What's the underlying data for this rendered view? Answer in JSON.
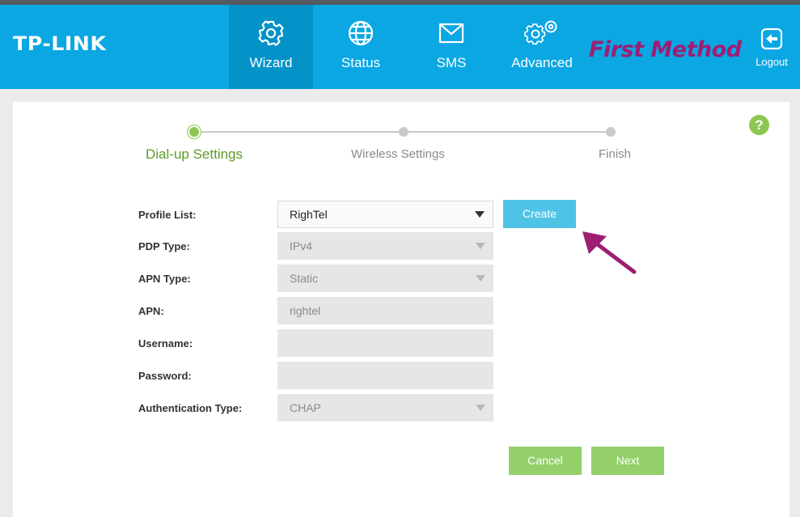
{
  "brand": {
    "logo": "TP-LINK"
  },
  "nav": {
    "items": [
      {
        "label": "Wizard",
        "icon": "gear-icon"
      },
      {
        "label": "Status",
        "icon": "globe-icon"
      },
      {
        "label": "SMS",
        "icon": "envelope-icon"
      },
      {
        "label": "Advanced",
        "icon": "gears-icon"
      }
    ],
    "logout_label": "Logout"
  },
  "annotation": {
    "text": "First Method",
    "color": "#9c1f74"
  },
  "steps": [
    {
      "label": "Dial-up Settings"
    },
    {
      "label": "Wireless Settings"
    },
    {
      "label": "Finish"
    }
  ],
  "help": {
    "label": "?"
  },
  "form": {
    "profile_list": {
      "label": "Profile List:",
      "value": "RighTel"
    },
    "pdp_type": {
      "label": "PDP Type:",
      "value": "IPv4"
    },
    "apn_type": {
      "label": "APN Type:",
      "value": "Static"
    },
    "apn": {
      "label": "APN:",
      "value": "rightel"
    },
    "username": {
      "label": "Username:",
      "value": ""
    },
    "password": {
      "label": "Password:",
      "value": ""
    },
    "auth_type": {
      "label": "Authentication Type:",
      "value": "CHAP"
    }
  },
  "buttons": {
    "create": "Create",
    "cancel": "Cancel",
    "next": "Next"
  },
  "colors": {
    "header": "#0aa7e3",
    "active_nav": "#0592c8",
    "green": "#8cc851",
    "create_button": "#4fc3e6"
  }
}
